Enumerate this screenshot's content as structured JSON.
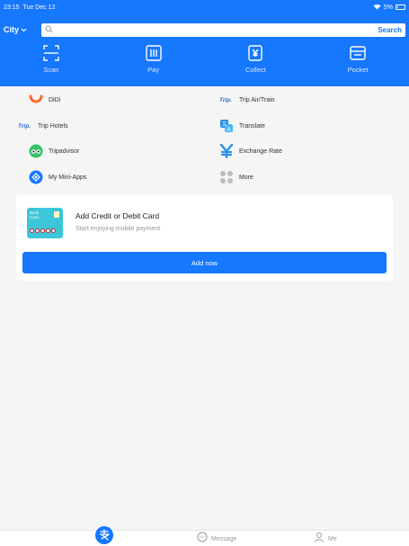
{
  "status": {
    "time": "23:15",
    "date": "Tue Dec 12",
    "battery": "5%"
  },
  "search": {
    "city": "City",
    "placeholder": "",
    "button": "Search"
  },
  "quick_actions": [
    {
      "label": "Scan",
      "icon": "scan-icon"
    },
    {
      "label": "Pay",
      "icon": "barcode-icon"
    },
    {
      "label": "Collect",
      "icon": "yuan-collect-icon"
    },
    {
      "label": "Pocket",
      "icon": "wallet-icon"
    }
  ],
  "services": [
    {
      "label": "DiDi",
      "icon": "didi-icon"
    },
    {
      "label": "Trip Air/Train",
      "icon": "trip-icon",
      "mark": "Trip."
    },
    {
      "label": "Trip Hotels",
      "icon": "trip-icon",
      "mark": "Trip."
    },
    {
      "label": "Translate",
      "icon": "translate-icon"
    },
    {
      "label": "Tripadvisor",
      "icon": "tripadvisor-icon"
    },
    {
      "label": "Exchange Rate",
      "icon": "exchange-rate-icon"
    },
    {
      "label": "My Mini-Apps",
      "icon": "mini-apps-icon"
    },
    {
      "label": "More",
      "icon": "more-icon"
    }
  ],
  "card": {
    "image_text_line1": "Bank",
    "image_text_line2": "Card",
    "title": "Add Credit or Debit Card",
    "subtitle": "Start enjoying mobile payment",
    "button": "Add now"
  },
  "tabs": [
    {
      "label": "",
      "icon": "alipay-home-icon",
      "active": true
    },
    {
      "label": "Message",
      "icon": "message-icon",
      "active": false
    },
    {
      "label": "Me",
      "icon": "person-icon",
      "active": false
    }
  ],
  "colors": {
    "primary": "#1677ff",
    "background": "#f5f5f5"
  }
}
